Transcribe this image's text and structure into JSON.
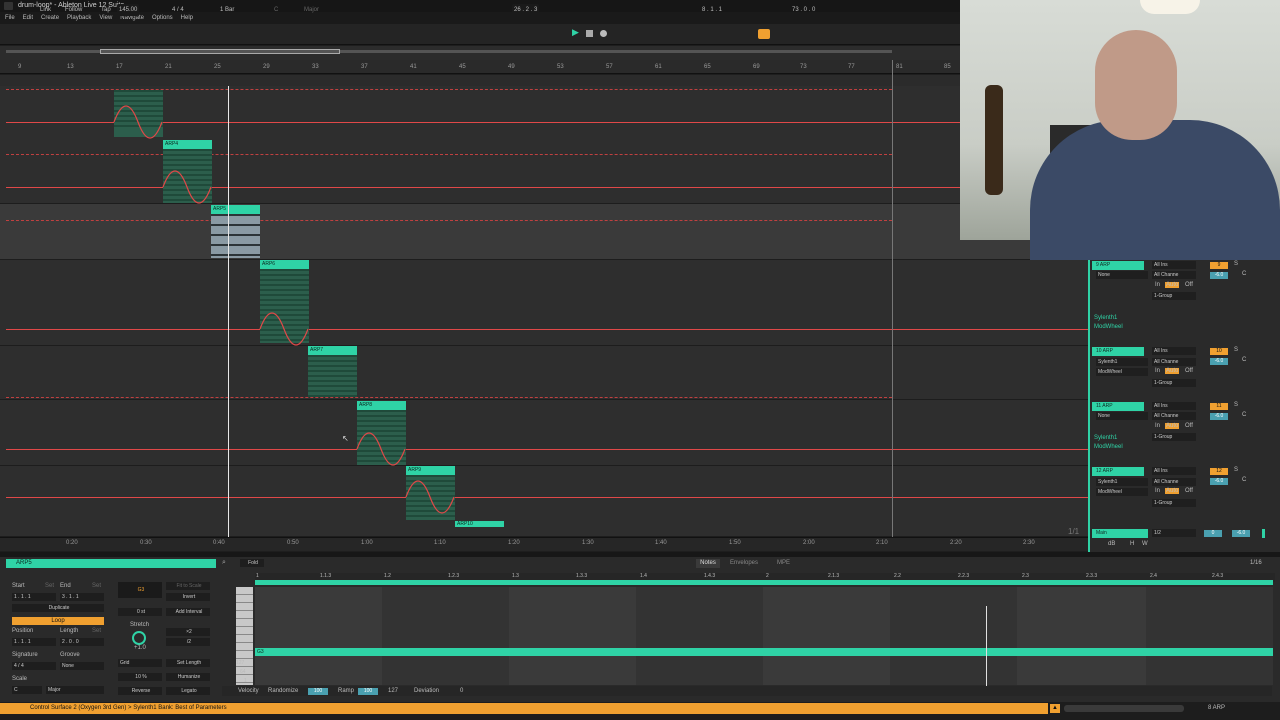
{
  "window": {
    "title": "drum-loop* - Ableton Live 12 Suite"
  },
  "menu": [
    "File",
    "Edit",
    "Create",
    "Playback",
    "View",
    "Navigate",
    "Options",
    "Help"
  ],
  "transport": {
    "link": "Link",
    "follow": "Follow",
    "tap": "Tap",
    "tempo": "145.00",
    "signature": "4 / 4",
    "quantize": "1 Bar",
    "position": "26 .  2 .  3",
    "loop_start": "8 .  1 .  1",
    "loop_length": "73 .  0 .  0",
    "key": "C",
    "scale": "Major"
  },
  "arrangement": {
    "bar_ticks": [
      "9",
      "13",
      "17",
      "21",
      "25",
      "29",
      "33",
      "37",
      "41",
      "45",
      "49",
      "53",
      "57",
      "61",
      "65",
      "69",
      "73",
      "77",
      "81",
      "85"
    ],
    "time_ticks": [
      "0:20",
      "0:30",
      "0:40",
      "0:50",
      "1:00",
      "1:10",
      "1:20",
      "1:30",
      "1:40",
      "1:50",
      "2:00",
      "2:10",
      "2:20",
      "2:30"
    ],
    "clips": [
      "ARP4",
      "ARP5",
      "ARP6",
      "ARP7",
      "ARP8",
      "ARP9",
      "ARP10"
    ],
    "fraction": "1/1"
  },
  "mixer": {
    "group_label": "1-Group",
    "tracks": [
      {
        "name": "9 ARP",
        "input": "All Ins",
        "source": "None",
        "channel": "All Channe",
        "number": "9",
        "volume": "-6.0",
        "device": "Sylenth1",
        "param": "ModWheel"
      },
      {
        "name": "10 ARP",
        "input": "All Ins",
        "source": "Sylenth1",
        "channel": "All Channe",
        "number": "10",
        "volume": "-6.0",
        "device": "",
        "param": "ModWheel"
      },
      {
        "name": "11 ARP",
        "input": "All Ins",
        "source": "None",
        "channel": "All Channe",
        "number": "11",
        "volume": "-6.0",
        "device": "Sylenth1",
        "param": "ModWheel"
      },
      {
        "name": "12 ARP",
        "input": "All Ins",
        "source": "Sylenth1",
        "channel": "All Channe",
        "number": "12",
        "volume": "-6.0",
        "device": "",
        "param": "ModWheel"
      }
    ],
    "monitor": {
      "in": "In",
      "auto": "Auto",
      "off": "Off"
    },
    "solo": "S",
    "cue": "C",
    "main": {
      "name": "Main",
      "output": "1/2",
      "volume": "0",
      "pan": "-6.0",
      "dB": "dB",
      "h": "H",
      "w": "W"
    }
  },
  "clip_view": {
    "title": "ARP5",
    "labels": {
      "start": "Start",
      "end": "End",
      "set": "Set",
      "position": "Position",
      "length": "Length",
      "signature": "Signature",
      "groove": "Groove",
      "scale": "Scale"
    },
    "start": "1 .  1 .  1",
    "end": "3 .  1 .  1",
    "duplicate": "Duplicate",
    "loop": "Loop",
    "position": "1 .  1 .  1",
    "length": "2 .  0 .  0",
    "signature": "4  /  4",
    "groove": "None",
    "scale_key": "C",
    "scale_name": "Major",
    "note": "G3",
    "fit_to_scale": "Fit to Scale",
    "invert": "Invert",
    "transpose": "0 st",
    "add_interval": "Add Interval",
    "stretch": "Stretch",
    "stretch_value": "+1.0",
    "x2": "×2",
    "div2": "/2",
    "grid": "Grid",
    "set_length": "Set Length",
    "humanize_pct": "10 %",
    "humanize": "Humanize",
    "reverse": "Reverse",
    "legato": "Legato",
    "fold": "Fold",
    "tabs": [
      "Notes",
      "Envelopes",
      "MPE"
    ],
    "grid_value": "1/16",
    "ruler": [
      "1",
      "1.1.3",
      "1.2",
      "1.2.3",
      "1.3",
      "1.3.3",
      "1.4",
      "1.4.3",
      "2",
      "2.1.3",
      "2.2",
      "2.2.3",
      "2.3",
      "2.3.3",
      "2.4",
      "2.4.3"
    ],
    "velocity_label": "Velocity",
    "randomize": "Randomize",
    "randomize_value": "100",
    "ramp": "Ramp",
    "ramp_value": "100",
    "ramp_end": "127",
    "deviation": "Deviation",
    "deviation_value": "0",
    "vel_scale": [
      "127",
      "64",
      "1"
    ]
  },
  "status": {
    "message": "Control Surface 2 (Oxygen  3rd  Gen) > Sylenth1 Bank: Best of Parameters",
    "track": "8 ARP"
  }
}
